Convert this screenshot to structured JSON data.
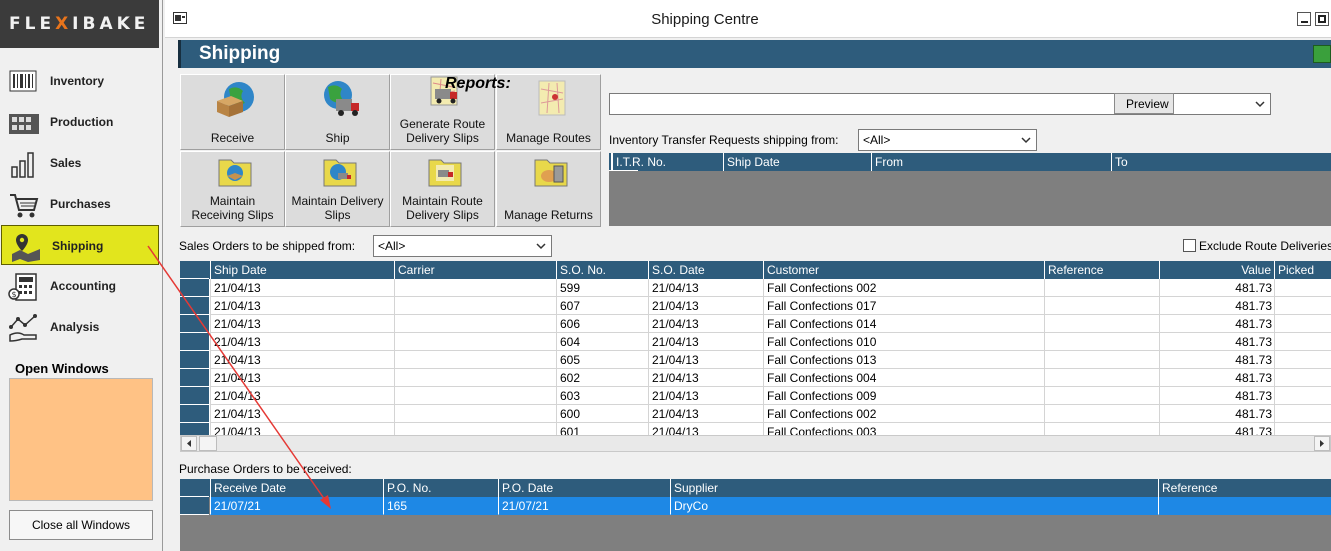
{
  "app": {
    "logo_text_a": "FLE",
    "logo_text_x": "X",
    "logo_text_b": "IBAKE"
  },
  "sidebar": {
    "items": [
      {
        "label": "Inventory",
        "icon": "barcode-icon"
      },
      {
        "label": "Production",
        "icon": "production-icon"
      },
      {
        "label": "Sales",
        "icon": "bar-chart-icon"
      },
      {
        "label": "Purchases",
        "icon": "cart-icon"
      },
      {
        "label": "Shipping",
        "icon": "map-pin-icon",
        "active": true
      },
      {
        "label": "Accounting",
        "icon": "calculator-icon"
      },
      {
        "label": "Analysis",
        "icon": "analysis-icon"
      }
    ],
    "open_windows_label": "Open Windows",
    "close_all_label": "Close all Windows"
  },
  "window": {
    "title": "Shipping Centre",
    "header": "Shipping"
  },
  "actions": {
    "receive": "Receive",
    "ship": "Ship",
    "gen_route_1": "Generate Route",
    "gen_route_2": "Delivery Slips",
    "manage_routes": "Manage Routes",
    "maint_recv_1": "Maintain",
    "maint_recv_2": "Receiving Slips",
    "maint_deliv_1": "Maintain Delivery",
    "maint_deliv_2": "Slips",
    "maint_route_1": "Maintain Route",
    "maint_route_2": "Delivery Slips",
    "manage_returns": "Manage Returns"
  },
  "reports": {
    "label": "Reports:",
    "selected": "",
    "preview_label": "Preview"
  },
  "itr": {
    "label": "Inventory Transfer Requests shipping from:",
    "filter": "<All>",
    "columns": [
      "I.T.R. No.",
      "Ship Date",
      "From",
      "To"
    ]
  },
  "sales_orders": {
    "label": "Sales Orders to be shipped from:",
    "filter": "<All>",
    "exclude_label": "Exclude Route Deliveries",
    "columns": [
      "Ship Date",
      "Carrier",
      "S.O. No.",
      "S.O. Date",
      "Customer",
      "Reference",
      "Value",
      "Picked"
    ],
    "rows": [
      [
        "21/04/13",
        "",
        "599",
        "21/04/13",
        "Fall Confections 002",
        "",
        "481.73",
        ""
      ],
      [
        "21/04/13",
        "",
        "607",
        "21/04/13",
        "Fall Confections 017",
        "",
        "481.73",
        ""
      ],
      [
        "21/04/13",
        "",
        "606",
        "21/04/13",
        "Fall Confections 014",
        "",
        "481.73",
        ""
      ],
      [
        "21/04/13",
        "",
        "604",
        "21/04/13",
        "Fall Confections 010",
        "",
        "481.73",
        ""
      ],
      [
        "21/04/13",
        "",
        "605",
        "21/04/13",
        "Fall Confections 013",
        "",
        "481.73",
        ""
      ],
      [
        "21/04/13",
        "",
        "602",
        "21/04/13",
        "Fall Confections 004",
        "",
        "481.73",
        ""
      ],
      [
        "21/04/13",
        "",
        "603",
        "21/04/13",
        "Fall Confections 009",
        "",
        "481.73",
        ""
      ],
      [
        "21/04/13",
        "",
        "600",
        "21/04/13",
        "Fall Confections 002",
        "",
        "481.73",
        ""
      ],
      [
        "21/04/13",
        "",
        "601",
        "21/04/13",
        "Fall Confections 003",
        "",
        "481.73",
        ""
      ]
    ]
  },
  "purchase_orders": {
    "label": "Purchase Orders to be received:",
    "columns": [
      "Receive Date",
      "P.O. No.",
      "P.O. Date",
      "Supplier",
      "Reference"
    ],
    "rows": [
      [
        "21/07/21",
        "165",
        "21/07/21",
        "DryCo",
        ""
      ]
    ]
  },
  "colors": {
    "header_blue": "#2e5c7c",
    "selection_blue": "#1e88e5",
    "sidebar_active": "#e2e51d",
    "annotation_red": "#e53935"
  }
}
